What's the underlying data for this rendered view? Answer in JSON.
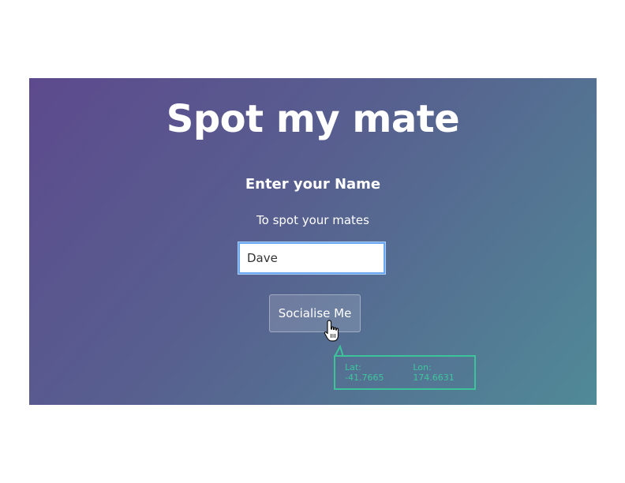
{
  "header": {
    "title": "Spot my mate"
  },
  "form": {
    "heading": "Enter your Name",
    "subtitle": "To spot your mates",
    "name_value": "Dave",
    "submit_label": "Socialise Me"
  },
  "location_tooltip": {
    "lat_text": "Lat: -41.7665",
    "lon_text": "Lon: 174.6631"
  },
  "colors": {
    "gradient_start": "#5d4a8e",
    "gradient_end": "#508a97",
    "tooltip_accent": "#3cc39a",
    "input_focus": "#6aa8f2"
  },
  "icons": {
    "pointer": "hand-pointer-icon"
  }
}
